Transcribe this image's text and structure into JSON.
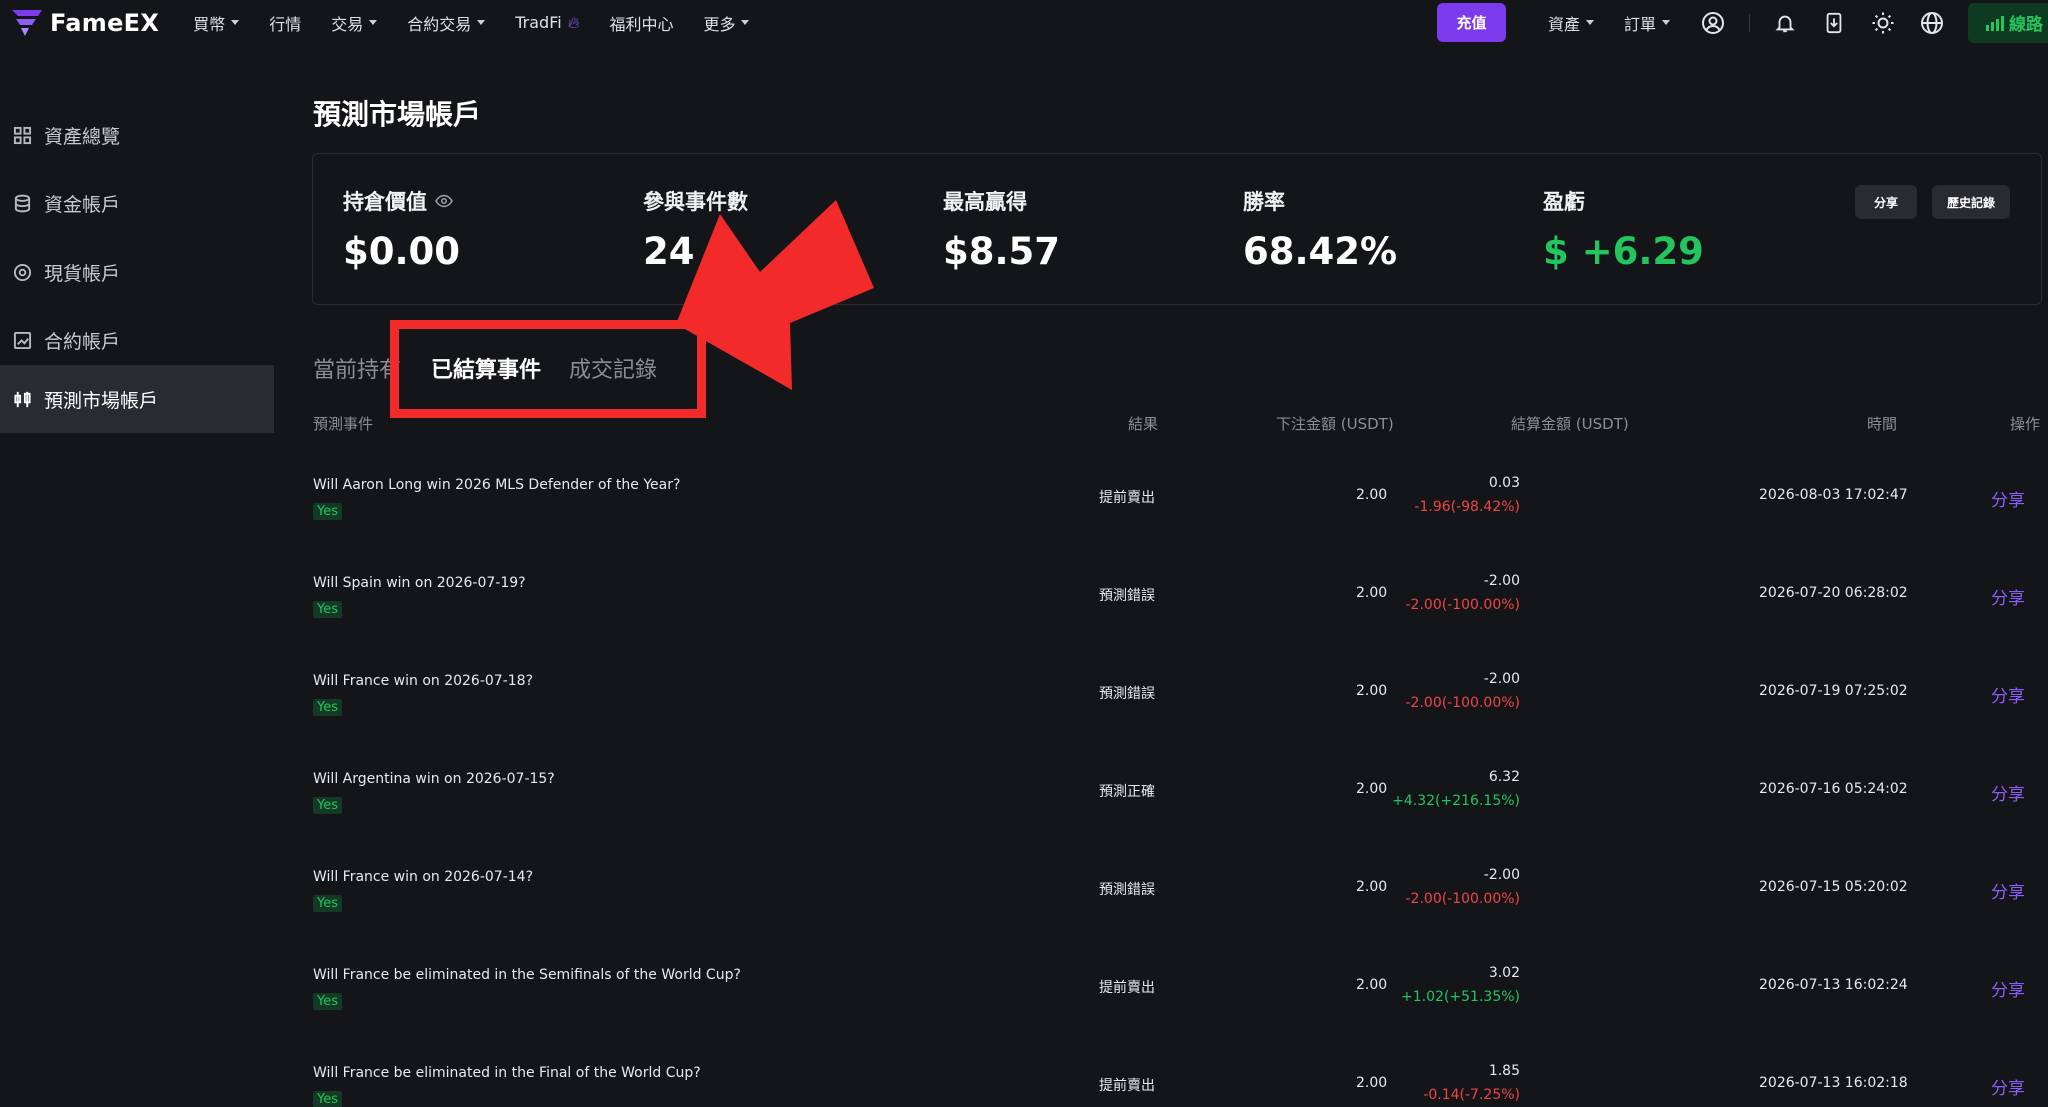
{
  "brand": {
    "name": "FameEX",
    "accent": "#7c3aed",
    "positive": "#22c55e",
    "negative": "#ef4444"
  },
  "nav": {
    "items": [
      {
        "label": "買幣",
        "dropdown": true
      },
      {
        "label": "行情",
        "dropdown": false
      },
      {
        "label": "交易",
        "dropdown": true
      },
      {
        "label": "合約交易",
        "dropdown": true
      },
      {
        "label": "TradFi",
        "dropdown": false,
        "icon": "fire-icon"
      },
      {
        "label": "福利中心",
        "dropdown": false
      },
      {
        "label": "更多",
        "dropdown": true
      }
    ],
    "deposit_label": "充值",
    "assets_label": "資產",
    "orders_label": "訂單",
    "line_label": "線路",
    "icons": [
      "user-icon",
      "bell-icon",
      "download-icon",
      "theme-icon",
      "globe-icon",
      "signal-icon"
    ]
  },
  "sidebar": {
    "items": [
      {
        "label": "資產總覽",
        "icon": "grid-icon",
        "active": false
      },
      {
        "label": "資金帳戶",
        "icon": "database-icon",
        "active": false
      },
      {
        "label": "現貨帳戶",
        "icon": "target-icon",
        "active": false
      },
      {
        "label": "合約帳戶",
        "icon": "chart-icon",
        "active": false
      },
      {
        "label": "預測市場帳戶",
        "icon": "prediction-icon",
        "active": true
      }
    ]
  },
  "page": {
    "title": "預測市場帳戶"
  },
  "summary": {
    "position_value_label": "持倉價值",
    "position_value": "$0.00",
    "events_label": "參與事件數",
    "events": "24",
    "max_win_label": "最高贏得",
    "max_win": "$8.57",
    "win_rate_label": "勝率",
    "win_rate": "68.42%",
    "pnl_label": "盈虧",
    "pnl": "$ +6.29",
    "share_label": "分享",
    "history_label": "歷史記錄"
  },
  "tabs": {
    "current": "當前持有",
    "settled": "已結算事件",
    "trades": "成交記錄",
    "active": "已結算事件"
  },
  "table": {
    "headers": {
      "event": "預測事件",
      "result": "結果",
      "bet": "下注金額 (USDT)",
      "settle": "結算金額 (USDT)",
      "time": "時間",
      "action": "操作"
    },
    "rows": [
      {
        "title": "Will Aaron Long win 2026 MLS Defender of the Year?",
        "tag": "Yes",
        "result": "提前賣出",
        "bet": "2.00",
        "settle": "0.03",
        "pnl": "-1.96(-98.42%)",
        "pnl_sign": "neg",
        "time": "2026-08-03 17:02:47",
        "action": "分享"
      },
      {
        "title": "Will Spain win on 2026-07-19?",
        "tag": "Yes",
        "result": "預測錯誤",
        "bet": "2.00",
        "settle": "-2.00",
        "pnl": "-2.00(-100.00%)",
        "pnl_sign": "neg",
        "time": "2026-07-20 06:28:02",
        "action": "分享"
      },
      {
        "title": "Will France win on 2026-07-18?",
        "tag": "Yes",
        "result": "預測錯誤",
        "bet": "2.00",
        "settle": "-2.00",
        "pnl": "-2.00(-100.00%)",
        "pnl_sign": "neg",
        "time": "2026-07-19 07:25:02",
        "action": "分享"
      },
      {
        "title": "Will Argentina win on 2026-07-15?",
        "tag": "Yes",
        "result": "預測正確",
        "bet": "2.00",
        "settle": "6.32",
        "pnl": "+4.32(+216.15%)",
        "pnl_sign": "pos",
        "time": "2026-07-16 05:24:02",
        "action": "分享"
      },
      {
        "title": "Will France win on 2026-07-14?",
        "tag": "Yes",
        "result": "預測錯誤",
        "bet": "2.00",
        "settle": "-2.00",
        "pnl": "-2.00(-100.00%)",
        "pnl_sign": "neg",
        "time": "2026-07-15 05:20:02",
        "action": "分享"
      },
      {
        "title": "Will France be eliminated in the Semifinals of the World Cup?",
        "tag": "Yes",
        "result": "提前賣出",
        "bet": "2.00",
        "settle": "3.02",
        "pnl": "+1.02(+51.35%)",
        "pnl_sign": "pos",
        "time": "2026-07-13 16:02:24",
        "action": "分享"
      },
      {
        "title": "Will France be eliminated in the Final of the World Cup?",
        "tag": "Yes",
        "result": "提前賣出",
        "bet": "2.00",
        "settle": "1.85",
        "pnl": "-0.14(-7.25%)",
        "pnl_sign": "neg",
        "time": "2026-07-13 16:02:18",
        "action": "分享"
      }
    ]
  }
}
